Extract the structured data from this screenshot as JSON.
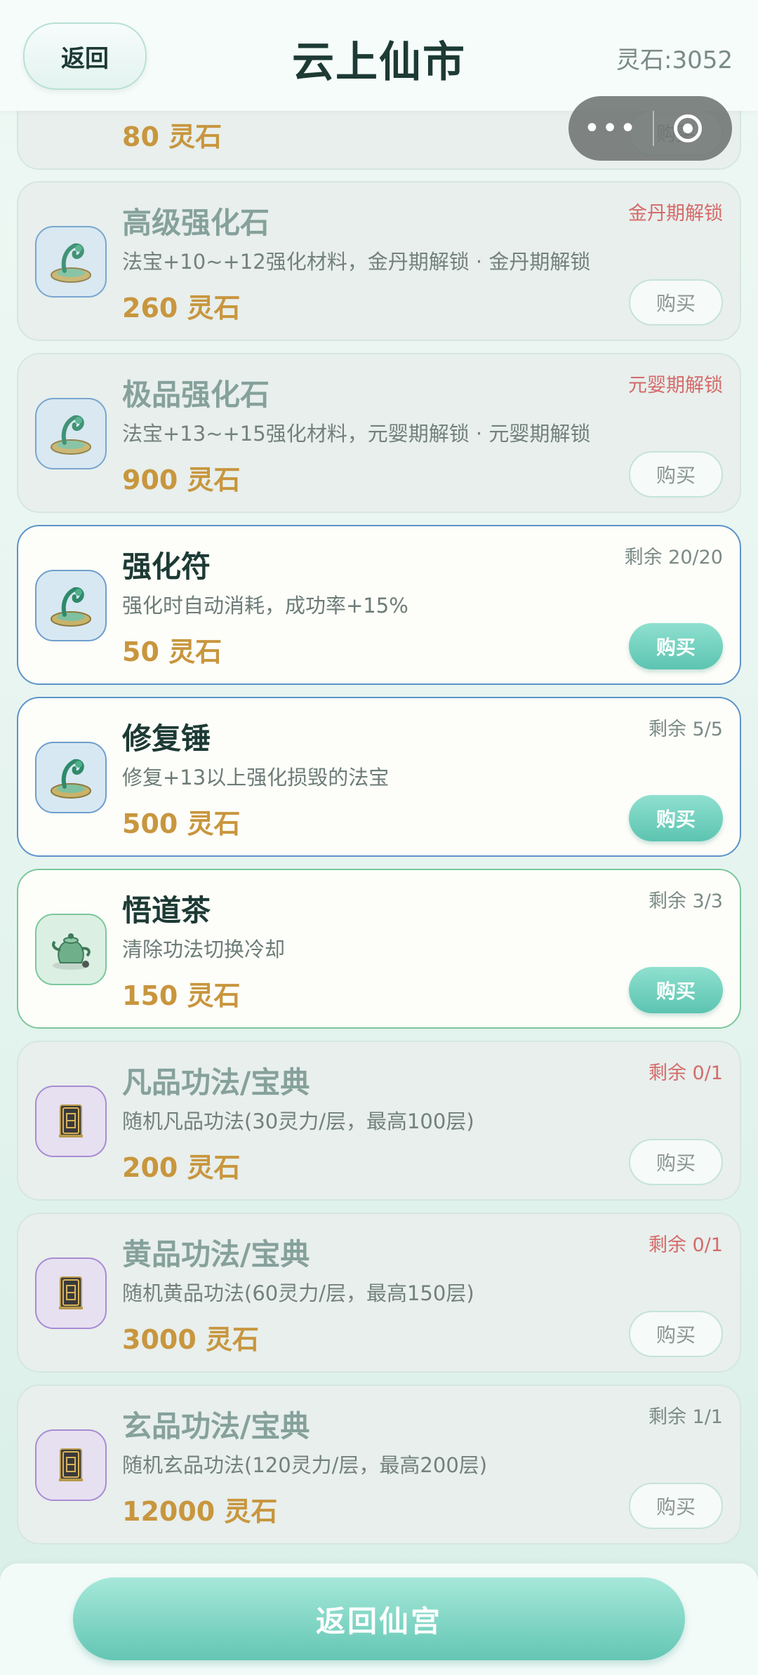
{
  "header": {
    "back_label": "返回",
    "title": "云上仙市",
    "balance": "灵石:3052"
  },
  "capsule": {
    "more": "•••"
  },
  "partial_card": {
    "price": "80 灵石",
    "buy_label": "购买"
  },
  "items": [
    {
      "name": "高级强化石",
      "desc": "法宝+10~+12强化材料，金丹期解锁 · 金丹期解锁",
      "price": "260 灵石",
      "status": "金丹期解锁",
      "buy_label": "购买",
      "icon": "refining-stone-icon"
    },
    {
      "name": "极品强化石",
      "desc": "法宝+13~+15强化材料，元婴期解锁 · 元婴期解锁",
      "price": "900 灵石",
      "status": "元婴期解锁",
      "buy_label": "购买",
      "icon": "refining-stone-icon"
    },
    {
      "name": "强化符",
      "desc": "强化时自动消耗，成功率+15%",
      "price": "50 灵石",
      "status": "剩余 20/20",
      "buy_label": "购买",
      "icon": "refining-stone-icon"
    },
    {
      "name": "修复锤",
      "desc": "修复+13以上强化损毁的法宝",
      "price": "500 灵石",
      "status": "剩余 5/5",
      "buy_label": "购买",
      "icon": "refining-stone-icon"
    },
    {
      "name": "悟道茶",
      "desc": "清除功法切换冷却",
      "price": "150 灵石",
      "status": "剩余 3/3",
      "buy_label": "购买",
      "icon": "teapot-icon"
    },
    {
      "name": "凡品功法/宝典",
      "desc": "随机凡品功法(30灵力/层，最高100层)",
      "price": "200 灵石",
      "status": "剩余 0/1",
      "buy_label": "购买",
      "icon": "scripture-book-icon"
    },
    {
      "name": "黄品功法/宝典",
      "desc": "随机黄品功法(60灵力/层，最高150层)",
      "price": "3000 灵石",
      "status": "剩余 0/1",
      "buy_label": "购买",
      "icon": "scripture-book-icon"
    },
    {
      "name": "玄品功法/宝典",
      "desc": "随机玄品功法(120灵力/层，最高200层)",
      "price": "12000 灵石",
      "status": "剩余 1/1",
      "buy_label": "购买",
      "icon": "scripture-book-icon"
    }
  ],
  "footer": {
    "return_label": "返回仙宫"
  },
  "colors": {
    "accent": "#5cc4b1",
    "price": "#c8963e",
    "locked_status": "#d56a6a",
    "active_border_blue": "#5c93c9",
    "active_border_green": "#7cc79b"
  }
}
